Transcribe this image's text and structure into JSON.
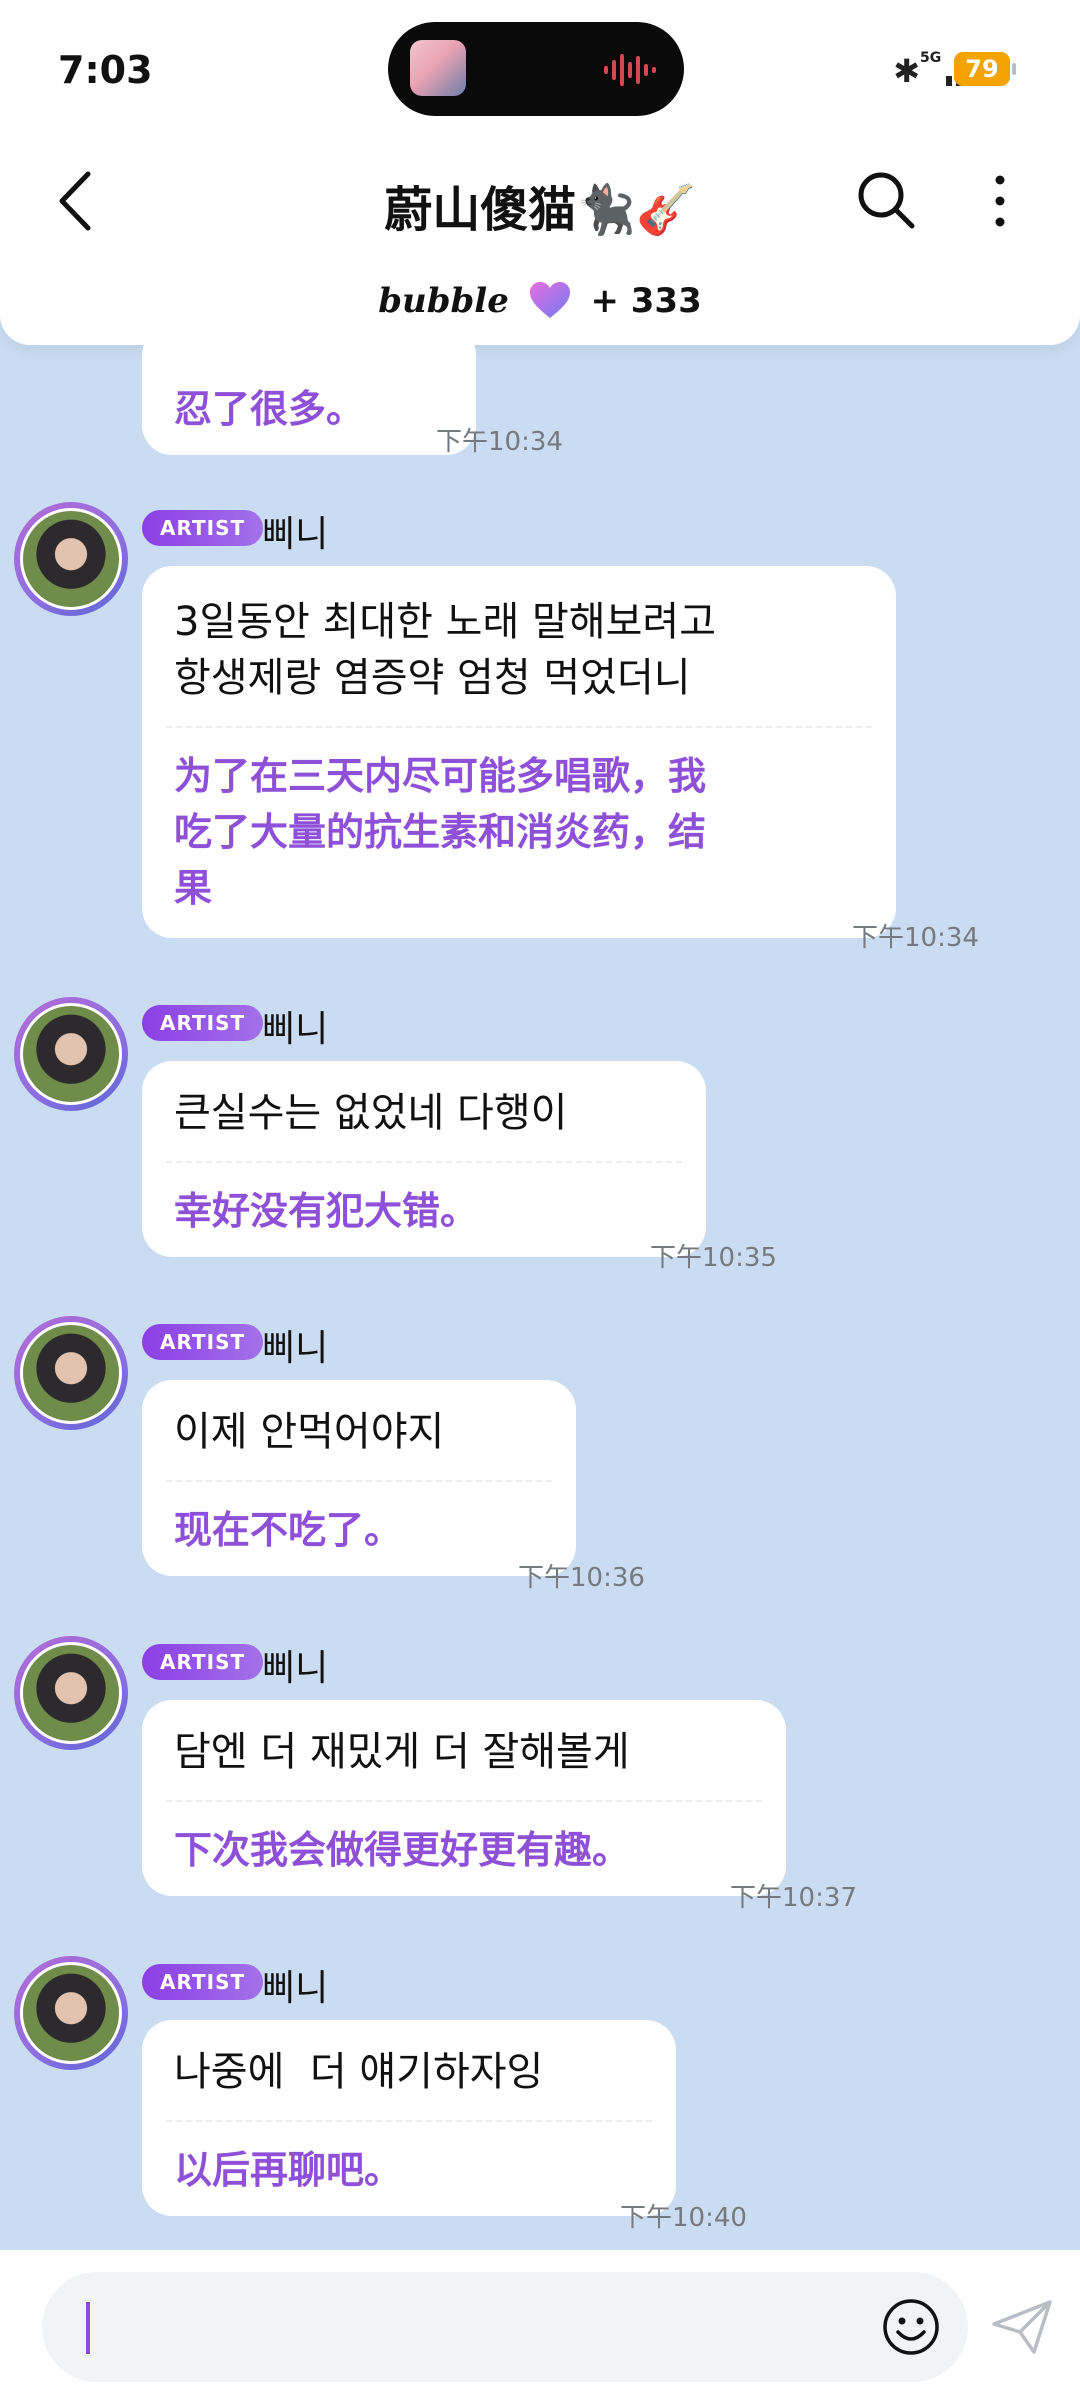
{
  "status": {
    "time": "7:03",
    "network": "5G",
    "battery": "79"
  },
  "header": {
    "title": "蔚山傻猫🐈‍⬛🎸",
    "bubble_logo": "bubble",
    "bubble_count": "+ 333"
  },
  "messages": [
    {
      "ko": "",
      "zh": "忍了很多。",
      "time": "下午10:34"
    },
    {
      "badge": "ARTIST",
      "sender": "삐니",
      "ko": "3일동안 최대한 노래 말해보려고\n항생제랑 염증약 엄청 먹었더니",
      "zh": "为了在三天内尽可能多唱歌，我\n吃了大量的抗生素和消炎药，结\n果",
      "time": "下午10:34"
    },
    {
      "badge": "ARTIST",
      "sender": "삐니",
      "ko": "큰실수는 없었네 다행이",
      "zh": "幸好没有犯大错。",
      "time": "下午10:35"
    },
    {
      "badge": "ARTIST",
      "sender": "삐니",
      "ko": "이제 안먹어야지",
      "zh": "现在不吃了。",
      "time": "下午10:36"
    },
    {
      "badge": "ARTIST",
      "sender": "삐니",
      "ko": "담엔 더 재밌게 더 잘해볼게",
      "zh": "下次我会做得更好更有趣。",
      "time": "下午10:37"
    },
    {
      "badge": "ARTIST",
      "sender": "삐니",
      "ko": "나중에  더 얘기하자잉",
      "zh": "以后再聊吧。",
      "time": "下午10:40"
    }
  ],
  "colors": {
    "accent": "#8e50d8",
    "chat_bg": "#c9dcf1",
    "badge": "#8b3fe6"
  }
}
